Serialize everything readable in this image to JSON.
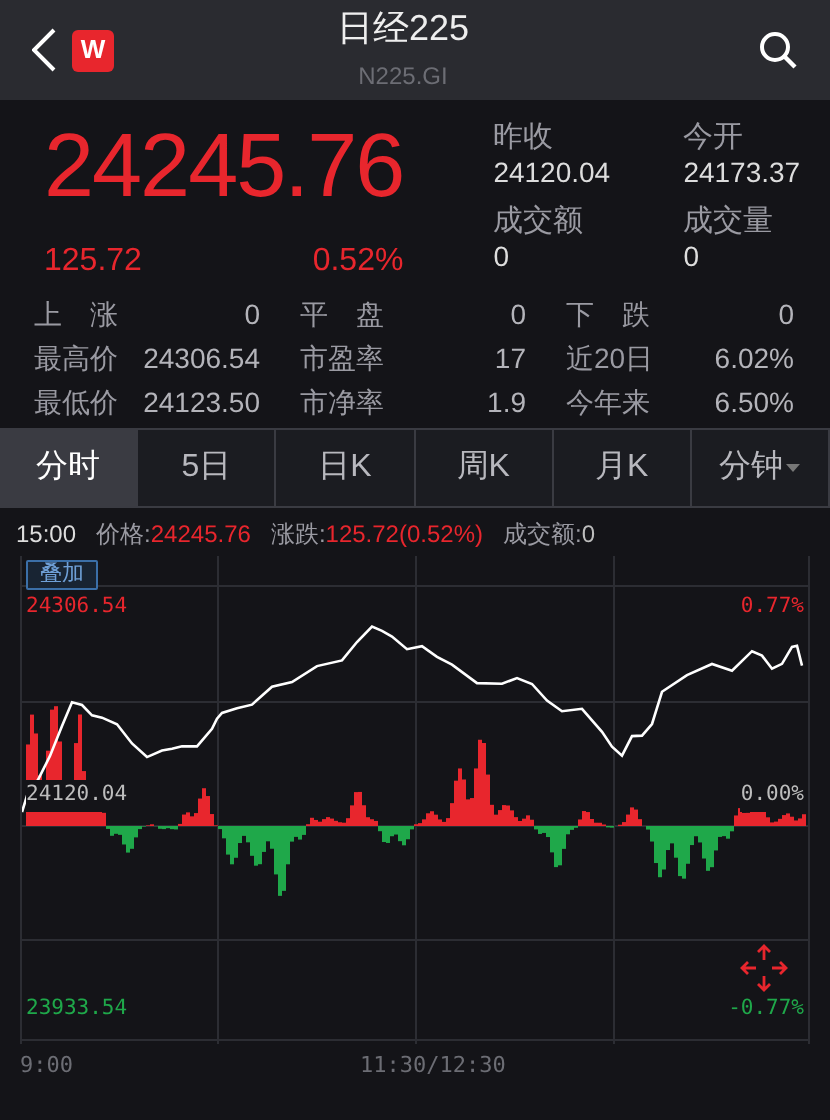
{
  "header": {
    "logo": "W",
    "title": "日经225",
    "code": "N225.GI"
  },
  "quote": {
    "price": "24245.76",
    "change": "125.72",
    "change_pct": "0.52%",
    "rising": true,
    "fields": [
      {
        "label": "昨收",
        "value": "24120.04"
      },
      {
        "label": "今开",
        "value": "24173.37"
      },
      {
        "label": "成交额",
        "value": "0"
      },
      {
        "label": "成交量",
        "value": "0"
      }
    ]
  },
  "stats": [
    {
      "label": "上　涨",
      "value": "0"
    },
    {
      "label": "平　盘",
      "value": "0"
    },
    {
      "label": "下　跌",
      "value": "0"
    },
    {
      "label": "最高价",
      "value": "24306.54"
    },
    {
      "label": "市盈率",
      "value": "17"
    },
    {
      "label": "近20日",
      "value": "6.02%"
    },
    {
      "label": "最低价",
      "value": "24123.50"
    },
    {
      "label": "市净率",
      "value": "1.9"
    },
    {
      "label": "今年来",
      "value": "6.50%"
    }
  ],
  "tabs": [
    {
      "label": "分时",
      "selected": true,
      "menu": false
    },
    {
      "label": "5日",
      "selected": false,
      "menu": false
    },
    {
      "label": "日K",
      "selected": false,
      "menu": false
    },
    {
      "label": "周K",
      "selected": false,
      "menu": false
    },
    {
      "label": "月K",
      "selected": false,
      "menu": false
    },
    {
      "label": "分钟",
      "selected": false,
      "menu": true
    }
  ],
  "info": {
    "time": "15:00",
    "items": [
      {
        "label": "价格:",
        "value": "24245.76",
        "color": "#e8262d"
      },
      {
        "label": "涨跌:",
        "value": "125.72(0.52%)",
        "color": "#e8262d"
      },
      {
        "label": "成交额:",
        "value": "0",
        "color": "#bdbdbd"
      }
    ]
  },
  "chart": {
    "overlay_button": "叠加",
    "levels": [
      {
        "price": "24306.54",
        "pct": "0.77%",
        "color": "#e8262d"
      },
      {
        "price": "24120.04",
        "pct": "0.00%",
        "color": "#bdbdbd"
      },
      {
        "price": "23933.54",
        "pct": "-0.77%",
        "color": "#1fa84a"
      }
    ],
    "x_labels": [
      "9:00",
      "11:30/12:30"
    ]
  }
}
